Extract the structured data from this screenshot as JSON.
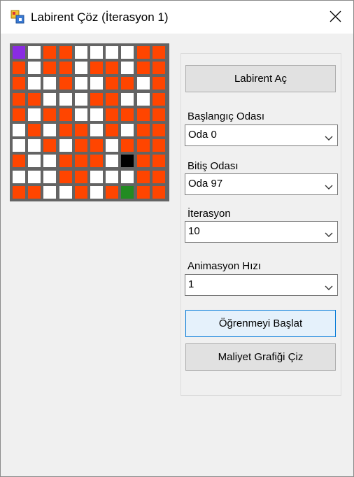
{
  "window": {
    "title": "Labirent Çöz (İterasyon 1)",
    "icon": "maze-app-icon"
  },
  "maze": {
    "rows": 10,
    "cols": 10,
    "state_colors": {
      "wall": "#ff4500",
      "open": "#ffffff",
      "start": "#8a2be2",
      "agent": "#000000",
      "goal": "#228b22"
    },
    "grid": [
      [
        "start",
        "open",
        "wall",
        "wall",
        "open",
        "open",
        "open",
        "open",
        "wall",
        "wall"
      ],
      [
        "wall",
        "open",
        "wall",
        "wall",
        "open",
        "wall",
        "wall",
        "open",
        "wall",
        "wall"
      ],
      [
        "wall",
        "open",
        "open",
        "wall",
        "open",
        "open",
        "wall",
        "wall",
        "open",
        "wall"
      ],
      [
        "wall",
        "wall",
        "open",
        "open",
        "open",
        "wall",
        "wall",
        "open",
        "open",
        "wall"
      ],
      [
        "wall",
        "open",
        "wall",
        "wall",
        "open",
        "open",
        "wall",
        "wall",
        "wall",
        "wall"
      ],
      [
        "open",
        "wall",
        "open",
        "wall",
        "wall",
        "open",
        "wall",
        "open",
        "wall",
        "wall"
      ],
      [
        "open",
        "open",
        "wall",
        "open",
        "wall",
        "wall",
        "open",
        "wall",
        "wall",
        "wall"
      ],
      [
        "wall",
        "open",
        "open",
        "wall",
        "wall",
        "wall",
        "open",
        "agent",
        "wall",
        "wall"
      ],
      [
        "open",
        "open",
        "open",
        "wall",
        "wall",
        "open",
        "open",
        "open",
        "wall",
        "wall"
      ],
      [
        "wall",
        "wall",
        "open",
        "open",
        "wall",
        "open",
        "wall",
        "goal",
        "wall",
        "wall"
      ]
    ]
  },
  "controls": {
    "open_maze_button": "Labirent Aç",
    "start_room_label": "Başlangıç Odası",
    "start_room_value": "Oda 0",
    "end_room_label": "Bitiş Odası",
    "end_room_value": "Oda 97",
    "iteration_label": "İterasyon",
    "iteration_value": "10",
    "speed_label": "Animasyon Hızı",
    "speed_value": "1",
    "start_learning_button": "Öğrenmeyi Başlat",
    "draw_cost_chart_button": "Maliyet Grafiği Çiz"
  }
}
